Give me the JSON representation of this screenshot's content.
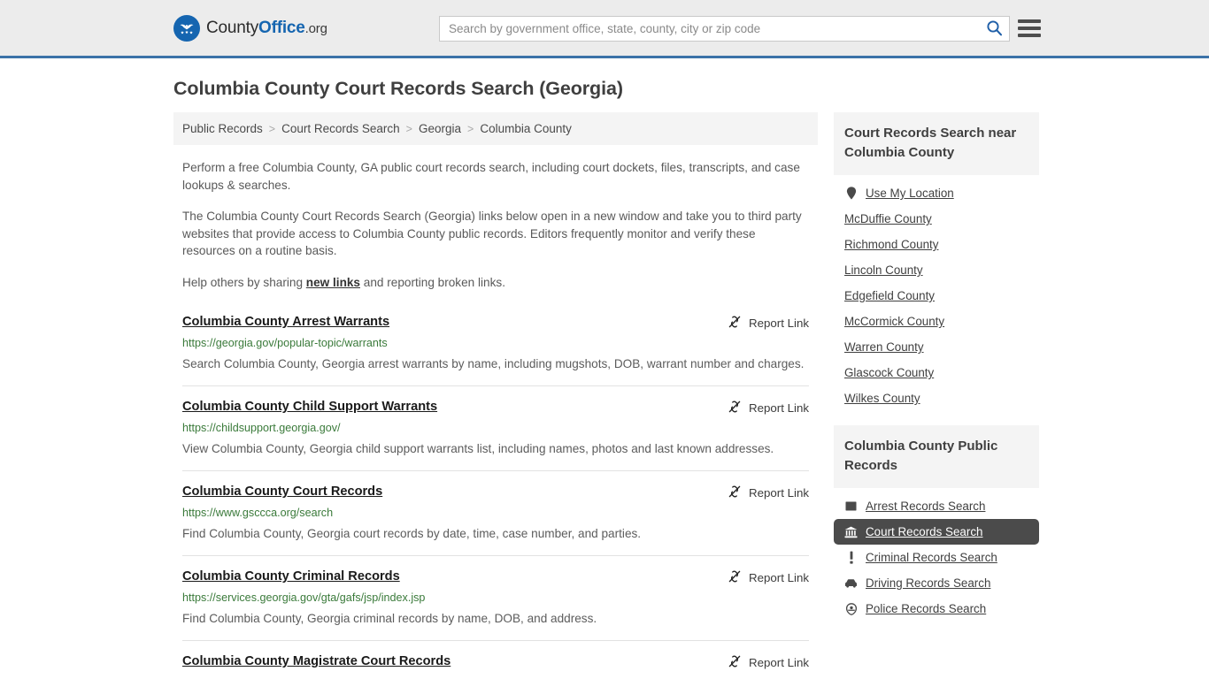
{
  "header": {
    "brand": {
      "part1": "County",
      "part2": "Office",
      "part3": ".org",
      "seal_icon": "eagle-seal-icon"
    },
    "search": {
      "placeholder": "Search by government office, state, county, city or zip code",
      "value": "",
      "search_icon": "search-icon"
    },
    "menu_icon": "hamburger-menu-icon"
  },
  "page": {
    "title": "Columbia County Court Records Search (Georgia)"
  },
  "breadcrumb": {
    "items": [
      {
        "label": "Public Records",
        "current": false
      },
      {
        "label": "Court Records Search",
        "current": false
      },
      {
        "label": "Georgia",
        "current": false
      },
      {
        "label": "Columbia County",
        "current": true
      }
    ],
    "separator": ">"
  },
  "intro": {
    "paragraph1": "Perform a free Columbia County, GA public court records search, including court dockets, files, transcripts, and case lookups & searches.",
    "paragraph2": "The Columbia County Court Records Search (Georgia) links below open in a new window and take you to third party websites that provide access to Columbia County public records. Editors frequently monitor and verify these resources on a routine basis.",
    "paragraph3_before": "Help others by sharing ",
    "paragraph3_link": "new links",
    "paragraph3_after": " and reporting broken links."
  },
  "results": {
    "report_label": "Report Link",
    "report_icon": "broken-link-icon",
    "items": [
      {
        "title": "Columbia County Arrest Warrants",
        "url": "https://georgia.gov/popular-topic/warrants",
        "description": "Search Columbia County, Georgia arrest warrants by name, including mugshots, DOB, warrant number and charges."
      },
      {
        "title": "Columbia County Child Support Warrants",
        "url": "https://childsupport.georgia.gov/",
        "description": "View Columbia County, Georgia child support warrants list, including names, photos and last known addresses."
      },
      {
        "title": "Columbia County Court Records",
        "url": "https://www.gsccca.org/search",
        "description": "Find Columbia County, Georgia court records by date, time, case number, and parties."
      },
      {
        "title": "Columbia County Criminal Records",
        "url": "https://services.georgia.gov/gta/gafs/jsp/index.jsp",
        "description": "Find Columbia County, Georgia criminal records by name, DOB, and address."
      },
      {
        "title": "Columbia County Magistrate Court Records",
        "url": "",
        "description": ""
      }
    ]
  },
  "sidebar": {
    "nearby": {
      "heading": "Court Records Search near Columbia County",
      "items": [
        {
          "label": "Use My Location",
          "icon": "map-pin-icon",
          "active": false
        },
        {
          "label": "McDuffie County",
          "icon": "",
          "active": false
        },
        {
          "label": "Richmond County",
          "icon": "",
          "active": false
        },
        {
          "label": "Lincoln County",
          "icon": "",
          "active": false
        },
        {
          "label": "Edgefield County",
          "icon": "",
          "active": false
        },
        {
          "label": "McCormick County",
          "icon": "",
          "active": false
        },
        {
          "label": "Warren County",
          "icon": "",
          "active": false
        },
        {
          "label": "Glascock County",
          "icon": "",
          "active": false
        },
        {
          "label": "Wilkes County",
          "icon": "",
          "active": false
        }
      ]
    },
    "public_records": {
      "heading": "Columbia County Public Records",
      "items": [
        {
          "label": "Arrest Records Search",
          "icon": "square-icon",
          "active": false
        },
        {
          "label": "Court Records Search",
          "icon": "courthouse-icon",
          "active": true
        },
        {
          "label": "Criminal Records Search",
          "icon": "exclamation-icon",
          "active": false
        },
        {
          "label": "Driving Records Search",
          "icon": "car-icon",
          "active": false
        },
        {
          "label": "Police Records Search",
          "icon": "police-badge-icon",
          "active": false
        }
      ]
    }
  },
  "colors": {
    "header_bg": "#ececec",
    "header_border": "#3c72a8",
    "brand_blue": "#1565b0",
    "url_green": "#3a7a3a",
    "active_bg": "#4b4b4b",
    "panel_bg": "#f4f4f4"
  }
}
